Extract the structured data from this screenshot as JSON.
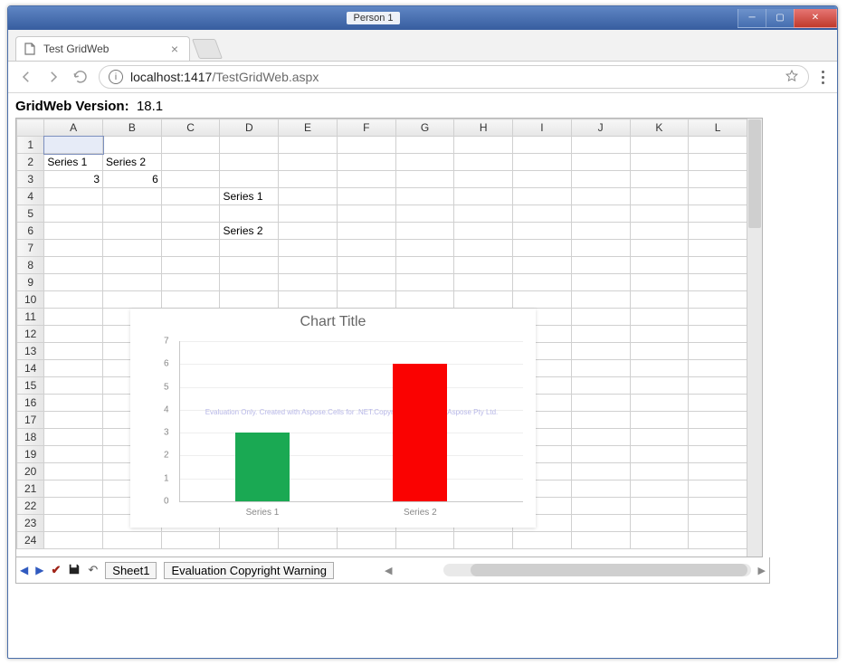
{
  "browser": {
    "person_label": "Person 1",
    "tab_title": "Test GridWeb",
    "url_host": "localhost:",
    "url_port": "1417",
    "url_path": "/TestGridWeb.aspx"
  },
  "page": {
    "version_label": "GridWeb Version:",
    "version_value": "18.1"
  },
  "columns": [
    "A",
    "B",
    "C",
    "D",
    "E",
    "F",
    "G",
    "H",
    "I",
    "J",
    "K",
    "L"
  ],
  "rows": 24,
  "cells": {
    "A2": "Series 1",
    "B2": "Series 2",
    "A3": "3",
    "B3": "6",
    "D4": "Series 1",
    "D6": "Series 2"
  },
  "mini_overlay": {
    "series1": "Series 1",
    "series2": "Series 2"
  },
  "footer": {
    "sheet1": "Sheet1",
    "warning": "Evaluation Copyright Warning"
  },
  "chart_data": {
    "type": "bar",
    "title": "Chart Title",
    "categories": [
      "Series 1",
      "Series 2"
    ],
    "values": [
      3,
      6
    ],
    "ylim": [
      0,
      7
    ],
    "yticks": [
      0,
      1,
      2,
      3,
      4,
      5,
      6,
      7
    ],
    "colors": [
      "#1aa953",
      "#fa0201"
    ],
    "watermark": "Evaluation Only. Created with Aspose.Cells for .NET.Copyright 2003 - 2018 Aspose Pty Ltd."
  }
}
